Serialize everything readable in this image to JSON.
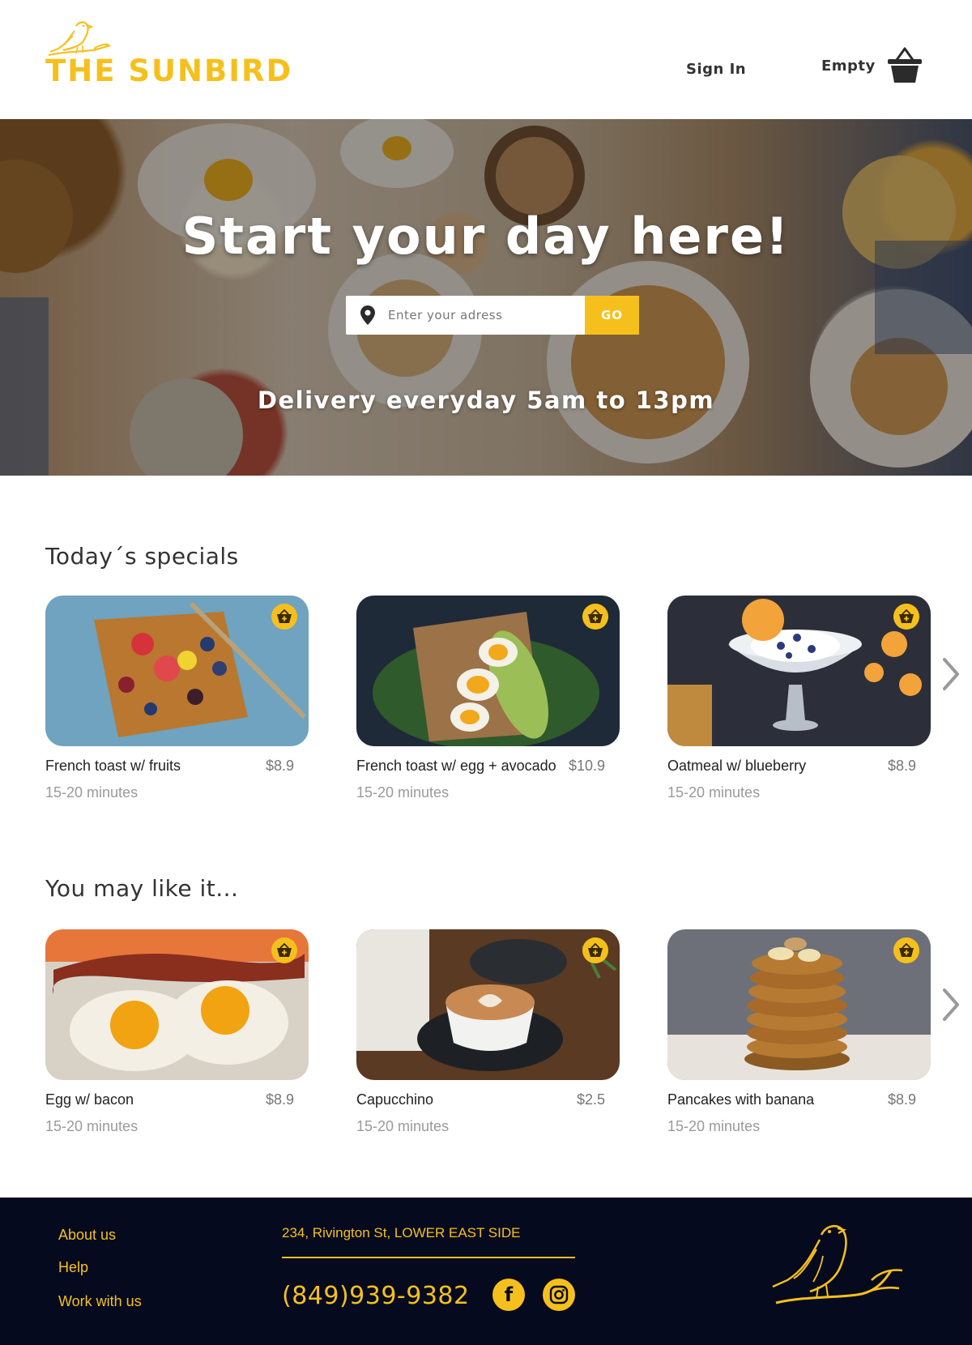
{
  "header": {
    "brand": "THE SUNBIRD",
    "sign_in": "Sign In",
    "cart_label": "Empty",
    "icons": {
      "logo": "sunbird-logo-icon",
      "cart": "basket-icon"
    }
  },
  "hero": {
    "title": "Start your day here!",
    "search_placeholder": "Enter your adress",
    "go_label": "GO",
    "subtitle": "Delivery everyday 5am to 13pm"
  },
  "specials": {
    "title": "Today´s specials",
    "items": [
      {
        "name": "French toast w/ fruits",
        "price": "$8.9",
        "time": "15-20 minutes"
      },
      {
        "name": "French toast w/ egg + avocado",
        "price": "$10.9",
        "time": "15-20 minutes"
      },
      {
        "name": "Oatmeal w/ blueberry",
        "price": "$8.9",
        "time": "15-20 minutes"
      }
    ]
  },
  "recommended": {
    "title": "You may like it...",
    "items": [
      {
        "name": "Egg w/ bacon",
        "price": "$8.9",
        "time": "15-20 minutes"
      },
      {
        "name": "Capucchino",
        "price": "$2.5",
        "time": "15-20 minutes"
      },
      {
        "name": "Pancakes with banana",
        "price": "$8.9",
        "time": "15-20 minutes"
      }
    ]
  },
  "footer": {
    "links": [
      "About us",
      "Help",
      "Work with us"
    ],
    "address": "234, Rivington St, LOWER EAST SIDE",
    "phone": "(849)939-9382",
    "social": [
      "facebook-icon",
      "instagram-icon"
    ]
  },
  "colors": {
    "accent": "#f6c01c",
    "footer_bg": "#060a1e",
    "text": "#2b2b2b",
    "muted": "#9a9a9a"
  }
}
